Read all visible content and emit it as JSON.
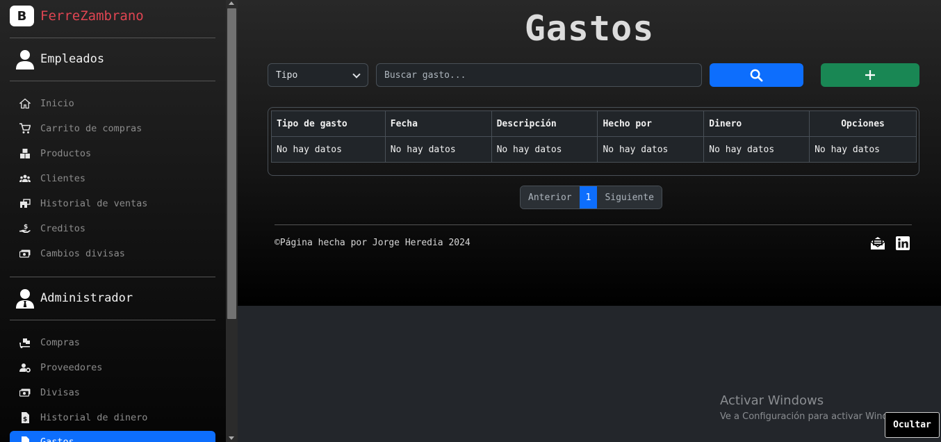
{
  "sidebar": {
    "brand_letter": "B",
    "brand_name": "FerreZambrano",
    "employees_section": "Empleados",
    "employees_items": [
      {
        "label": "Inicio",
        "icon": "home-icon"
      },
      {
        "label": "Carrito de compras",
        "icon": "cart-icon"
      },
      {
        "label": "Productos",
        "icon": "boxes-icon"
      },
      {
        "label": "Clientes",
        "icon": "people-icon"
      },
      {
        "label": "Historial de ventas",
        "icon": "store-history-icon"
      },
      {
        "label": "Creditos",
        "icon": "hand-coin-icon"
      },
      {
        "label": "Cambios divisas",
        "icon": "cash-icon"
      }
    ],
    "admin_section": "Administrador",
    "admin_items": [
      {
        "label": "Compras",
        "icon": "dolly-icon"
      },
      {
        "label": "Proveedores",
        "icon": "user-gear-icon"
      },
      {
        "label": "Divisas",
        "icon": "cash-icon"
      },
      {
        "label": "Historial de dinero",
        "icon": "file-dollar-icon"
      },
      {
        "label": "Gastos",
        "icon": "file-icon",
        "active": true
      }
    ]
  },
  "main": {
    "title": "Gastos",
    "filter_select": "Tipo",
    "search_placeholder": "Buscar gasto...",
    "search_button_icon": "search-icon",
    "add_button_icon": "plus-icon",
    "table": {
      "headers": [
        "Tipo de gasto",
        "Fecha",
        "Descripción",
        "Hecho por",
        "Dinero",
        "Opciones"
      ],
      "rows": [
        [
          "No hay datos",
          "No hay datos",
          "No hay datos",
          "No hay datos",
          "No hay datos",
          "No hay datos"
        ]
      ]
    },
    "pagination": {
      "prev": "Anterior",
      "current": "1",
      "next": "Siguiente"
    },
    "footer_text": "©Página hecha por Jorge Heredia 2024",
    "footer_icons": [
      "envelope-open-icon",
      "linkedin-icon"
    ]
  },
  "windows": {
    "activate_title": "Activar Windows",
    "activate_sub": "Ve a Configuración para activar Windows.",
    "hide_button": "Ocultar"
  },
  "colors": {
    "brand": "#e04552",
    "primary": "#0d6efd",
    "success": "#198754"
  }
}
